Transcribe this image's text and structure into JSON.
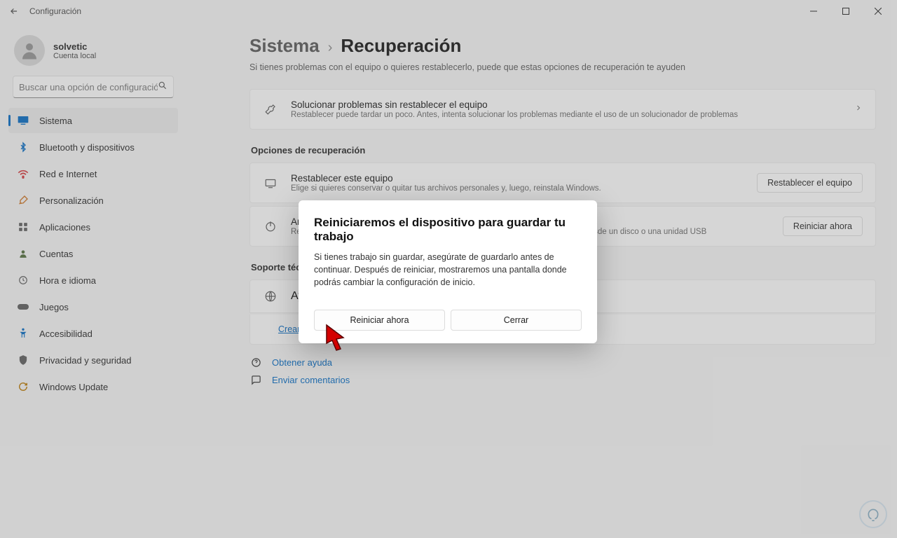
{
  "window": {
    "title": "Configuración"
  },
  "profile": {
    "name": "solvetic",
    "sub": "Cuenta local"
  },
  "search": {
    "placeholder": "Buscar una opción de configuración"
  },
  "nav": [
    {
      "key": "sistema",
      "label": "Sistema",
      "selected": true
    },
    {
      "key": "bluetooth",
      "label": "Bluetooth y dispositivos",
      "selected": false
    },
    {
      "key": "red",
      "label": "Red e Internet",
      "selected": false
    },
    {
      "key": "personalizacion",
      "label": "Personalización",
      "selected": false
    },
    {
      "key": "aplicaciones",
      "label": "Aplicaciones",
      "selected": false
    },
    {
      "key": "cuentas",
      "label": "Cuentas",
      "selected": false
    },
    {
      "key": "hora",
      "label": "Hora e idioma",
      "selected": false
    },
    {
      "key": "juegos",
      "label": "Juegos",
      "selected": false
    },
    {
      "key": "accesibilidad",
      "label": "Accesibilidad",
      "selected": false
    },
    {
      "key": "privacidad",
      "label": "Privacidad y seguridad",
      "selected": false
    },
    {
      "key": "update",
      "label": "Windows Update",
      "selected": false
    }
  ],
  "breadcrumb": {
    "sys": "Sistema",
    "sep": "›",
    "cur": "Recuperación"
  },
  "subtitle": "Si tienes problemas con el equipo o quieres restablecerlo, puede que estas opciones de recuperación te ayuden",
  "troubleshoot": {
    "title": "Solucionar problemas sin restablecer el equipo",
    "sub": "Restablecer puede tardar un poco. Antes, intenta solucionar los problemas mediante el uso de un solucionador de problemas"
  },
  "section_recovery": "Opciones de recuperación",
  "reset": {
    "title": "Restablecer este equipo",
    "sub": "Elige si quieres conservar o quitar tus archivos personales y, luego, reinstala Windows.",
    "btn": "Restablecer el equipo"
  },
  "advanced": {
    "title": "Arranque avanzado",
    "sub": "Reinicia el dispositivo para cambiar la configuración de inicio, incluido el arranque desde un disco o una unidad USB",
    "btn": "Reiniciar ahora"
  },
  "section_support": "Soporte técnico",
  "help": {
    "title": "Ayuda con la recuperación",
    "link": "Crear una unidad de recuperación"
  },
  "footer": {
    "help": "Obtener ayuda",
    "feedback": "Enviar comentarios"
  },
  "modal": {
    "title": "Reiniciaremos el dispositivo para guardar tu trabajo",
    "body": "Si tienes trabajo sin guardar, asegúrate de guardarlo antes de continuar. Después de reiniciar, mostraremos una pantalla donde podrás cambiar la configuración de inicio.",
    "primary": "Reiniciar ahora",
    "secondary": "Cerrar"
  }
}
